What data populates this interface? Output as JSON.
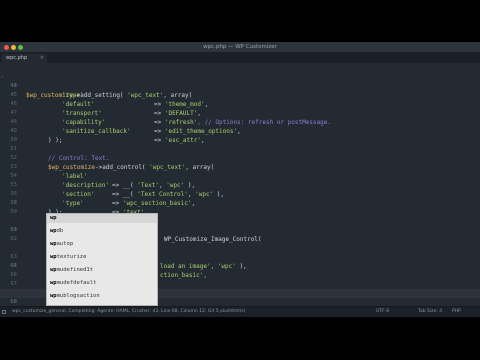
{
  "window": {
    "title": "wpc.php — WP Customizer"
  },
  "tab": {
    "label": "wpc.php",
    "close": "×"
  },
  "lines": [
    {
      "num": "43",
      "fold": ""
    },
    {
      "num": "44",
      "fold": ""
    },
    {
      "num": "45",
      "fold": ""
    },
    {
      "num": "46",
      "fold": ""
    },
    {
      "num": "47",
      "fold": ""
    },
    {
      "num": "48",
      "fold": ""
    },
    {
      "num": "49",
      "fold": ""
    },
    {
      "num": "50",
      "fold": ""
    },
    {
      "num": "51",
      "fold": ""
    },
    {
      "num": "52",
      "fold": ""
    },
    {
      "num": "53",
      "fold": ""
    },
    {
      "num": "54",
      "fold": ""
    },
    {
      "num": "55",
      "fold": ""
    },
    {
      "num": "56",
      "fold": ""
    },
    {
      "num": "57",
      "fold": ""
    },
    {
      "num": "58",
      "fold": ""
    },
    {
      "num": "59",
      "fold": ""
    },
    {
      "num": "60",
      "fold": ""
    },
    {
      "num": "61",
      "fold": ""
    },
    {
      "num": "62",
      "fold": ""
    },
    {
      "num": "63",
      "fold": ""
    },
    {
      "num": "64",
      "fold": ""
    },
    {
      "num": "65",
      "fold": ""
    },
    {
      "num": "66",
      "fold": ""
    },
    {
      "num": "67",
      "fold": ""
    },
    {
      "num": "68",
      "fold": ""
    },
    {
      "num": "69",
      "fold": ""
    }
  ],
  "code": {
    "l43_var": "$wp_customize",
    "l43_rest": "->add_setting( ",
    "l43_str": "'wpc_text'",
    "l43_end": ", array(",
    "l44_key": "'type'",
    "l44_op": "=> ",
    "l44_val": "'theme_mod'",
    "l45_key": "'default'",
    "l45_op": "=> ",
    "l45_val": "'DEFAULT'",
    "l46_key": "'transport'",
    "l46_op": "=> ",
    "l46_val": "'refresh'",
    "l46_cmt": ", // Options: refresh or postMessage.",
    "l47_key": "'capability'",
    "l47_op": "=> ",
    "l47_val": "'edit_theme_options'",
    "l48_key": "'sanitize_callback'",
    "l48_op": "=> ",
    "l48_val": "'esc_attr'",
    "l49": ") );",
    "l51_cmt": "// Control: Text.",
    "l52_var": "$wp_customize",
    "l52_rest": "->add_control( ",
    "l52_str": "'wpc_text'",
    "l52_end": ", array(",
    "l53_key": "'label'",
    "l53_op": "=> __( ",
    "l53_s1": "'Text'",
    "l53_s2": "'wpc'",
    "l53_end": " ),",
    "l54_key": "'description'",
    "l54_op": "=> __( ",
    "l54_s1": "'Text Control'",
    "l54_s2": "'wpc'",
    "l54_end": " ),",
    "l55_key": "'section'",
    "l55_op": "=> ",
    "l55_val": "'wpc_section_basic'",
    "l56_key": "'type'",
    "l56_op": "=> ",
    "l56_val": "'text'",
    "l57": ") );",
    "l60_frag": "WP_Customize_Image_Control(",
    "l63_frag1": "load an image', ",
    "l63_frag2": "'wpc'",
    "l63_frag3": " ),",
    "l64_frag": "ction_basic',",
    "l68_typed": "wp"
  },
  "popup": {
    "items": [
      {
        "match": "wp",
        "rest": ""
      },
      {
        "match": "wp",
        "rest": "db"
      },
      {
        "match": "wp",
        "rest": "autop"
      },
      {
        "match": "wp",
        "rest": "texturize"
      },
      {
        "match": "wp",
        "rest": "mudefined1t"
      },
      {
        "match": "wp",
        "rest": "mudefdefault"
      },
      {
        "match": "wp",
        "rest": "mublogsaction"
      }
    ]
  },
  "status": {
    "left": "wpc_customize_general, Completing: Agente: HAML, Crusher: 43, Line 68, Column 12; Git 5 plushtml(s)",
    "utf": "UTF-8",
    "tab": "Tab Size: 4",
    "lang": "PHP"
  }
}
